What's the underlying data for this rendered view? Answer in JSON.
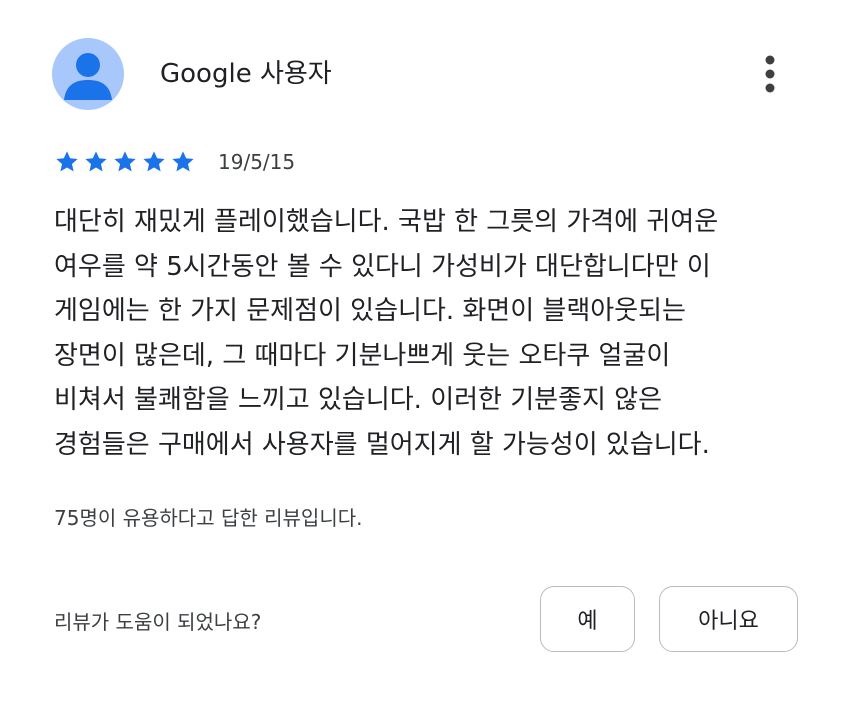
{
  "review": {
    "author": "Google 사용자",
    "avatar_icon": "person-icon",
    "more_icon": "more-vert-icon",
    "rating": 5,
    "rating_max": 5,
    "star_color": "#1a73e8",
    "date": "19/5/15",
    "text_lines": [
      "대단히 재밌게 플레이했습니다. 국밥 한 그릇의 가격에 귀여운",
      "여우를 약 5시간동안 볼 수 있다니 가성비가 대단합니다만 이",
      "게임에는 한 가지 문제점이 있습니다. 화면이 블랙아웃되는",
      "장면이 많은데, 그 때마다 기분나쁘게 웃는 오타쿠 얼굴이",
      "비쳐서 불쾌함을 느끼고 있습니다. 이러한 기분좋지 않은",
      "경험들은 구매에서 사용자를 멀어지게 할 가능성이 있습니다."
    ],
    "helpful_count_text": "75명이 유용하다고 답한 리뷰입니다."
  },
  "feedback": {
    "question": "리뷰가 도움이 되었나요?",
    "yes_label": "예",
    "no_label": "아니요"
  }
}
